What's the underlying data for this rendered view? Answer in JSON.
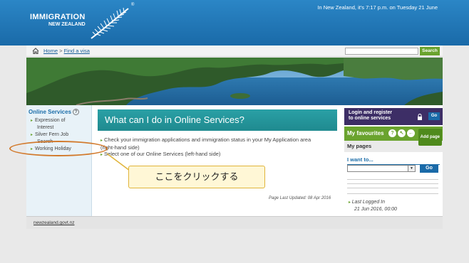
{
  "header": {
    "logo_main": "IMMIGRATION",
    "logo_sub": "NEW ZEALAND",
    "registered": "®",
    "date_line": "In New Zealand, it's 7:17 p.m. on Tuesday 21 June",
    "color": "#1f78b8"
  },
  "breadcrumb": {
    "home": "Home",
    "separator": ">",
    "current": "Find a visa"
  },
  "search": {
    "placeholder": "",
    "button": "Search"
  },
  "leftnav": {
    "title": "Online Services",
    "help": "?",
    "items": [
      {
        "label": "Expression of",
        "label2": "Interest"
      },
      {
        "label": "Silver Fern Job",
        "label2": "Search"
      },
      {
        "label": "Working Holiday"
      }
    ]
  },
  "content": {
    "title": "What can I do in Online Services?",
    "bullets": [
      "Check your immigration applications and immigration status in your My Application area",
      "(right-hand side)",
      "Select one of our Online Services (left-hand side)"
    ],
    "updated": "Page Last Updated: 08 Apr 2016"
  },
  "rightcol": {
    "login_line1": "Login and register",
    "login_line2": "to online services",
    "login_go": "Go",
    "favourites": "My favourites",
    "add_page": "Add page",
    "my_pages": "My pages",
    "i_want": "I want to...",
    "go": "Go",
    "last_logged_label": "Last Logged In",
    "last_logged_value": "21 Jun 2016, 00:00"
  },
  "footer": {
    "logo": "newzealand.govt.nz"
  },
  "annotation": {
    "callout_text": "ここをクリックする",
    "accent": "#d27a2c"
  }
}
